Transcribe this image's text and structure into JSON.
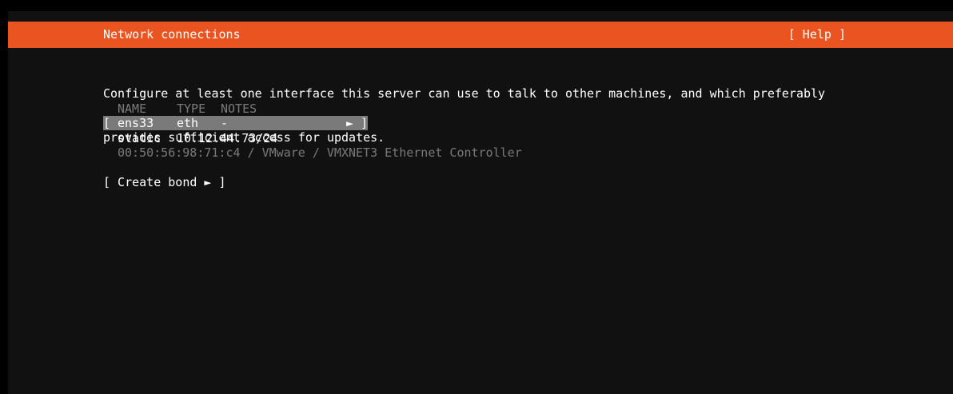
{
  "header": {
    "title": "Network connections",
    "help_label": "[ Help ]"
  },
  "description": {
    "line1": "Configure at least one interface this server can use to talk to other machines, and which preferably",
    "line2": "provides sufficient access for updates."
  },
  "table": {
    "columns": [
      "NAME",
      "TYPE",
      "NOTES"
    ],
    "interfaces": [
      {
        "bracket_open": "[",
        "name": "ens33",
        "type": "eth",
        "notes": "-",
        "arrow": "►",
        "bracket_close": "]",
        "selected": true,
        "addressing": "static",
        "address": "10.12.44.73/24",
        "hardware": "00:50:56:98:71:c4 / VMware / VMXNET3 Ethernet Controller"
      }
    ]
  },
  "create_bond": {
    "label": "[ Create bond ► ]"
  },
  "colors": {
    "header_bg": "#e95420",
    "screen_bg": "#111111",
    "selection_bg": "#7a7a7a",
    "dim_text": "#7a7a7a",
    "text": "#ffffff"
  }
}
